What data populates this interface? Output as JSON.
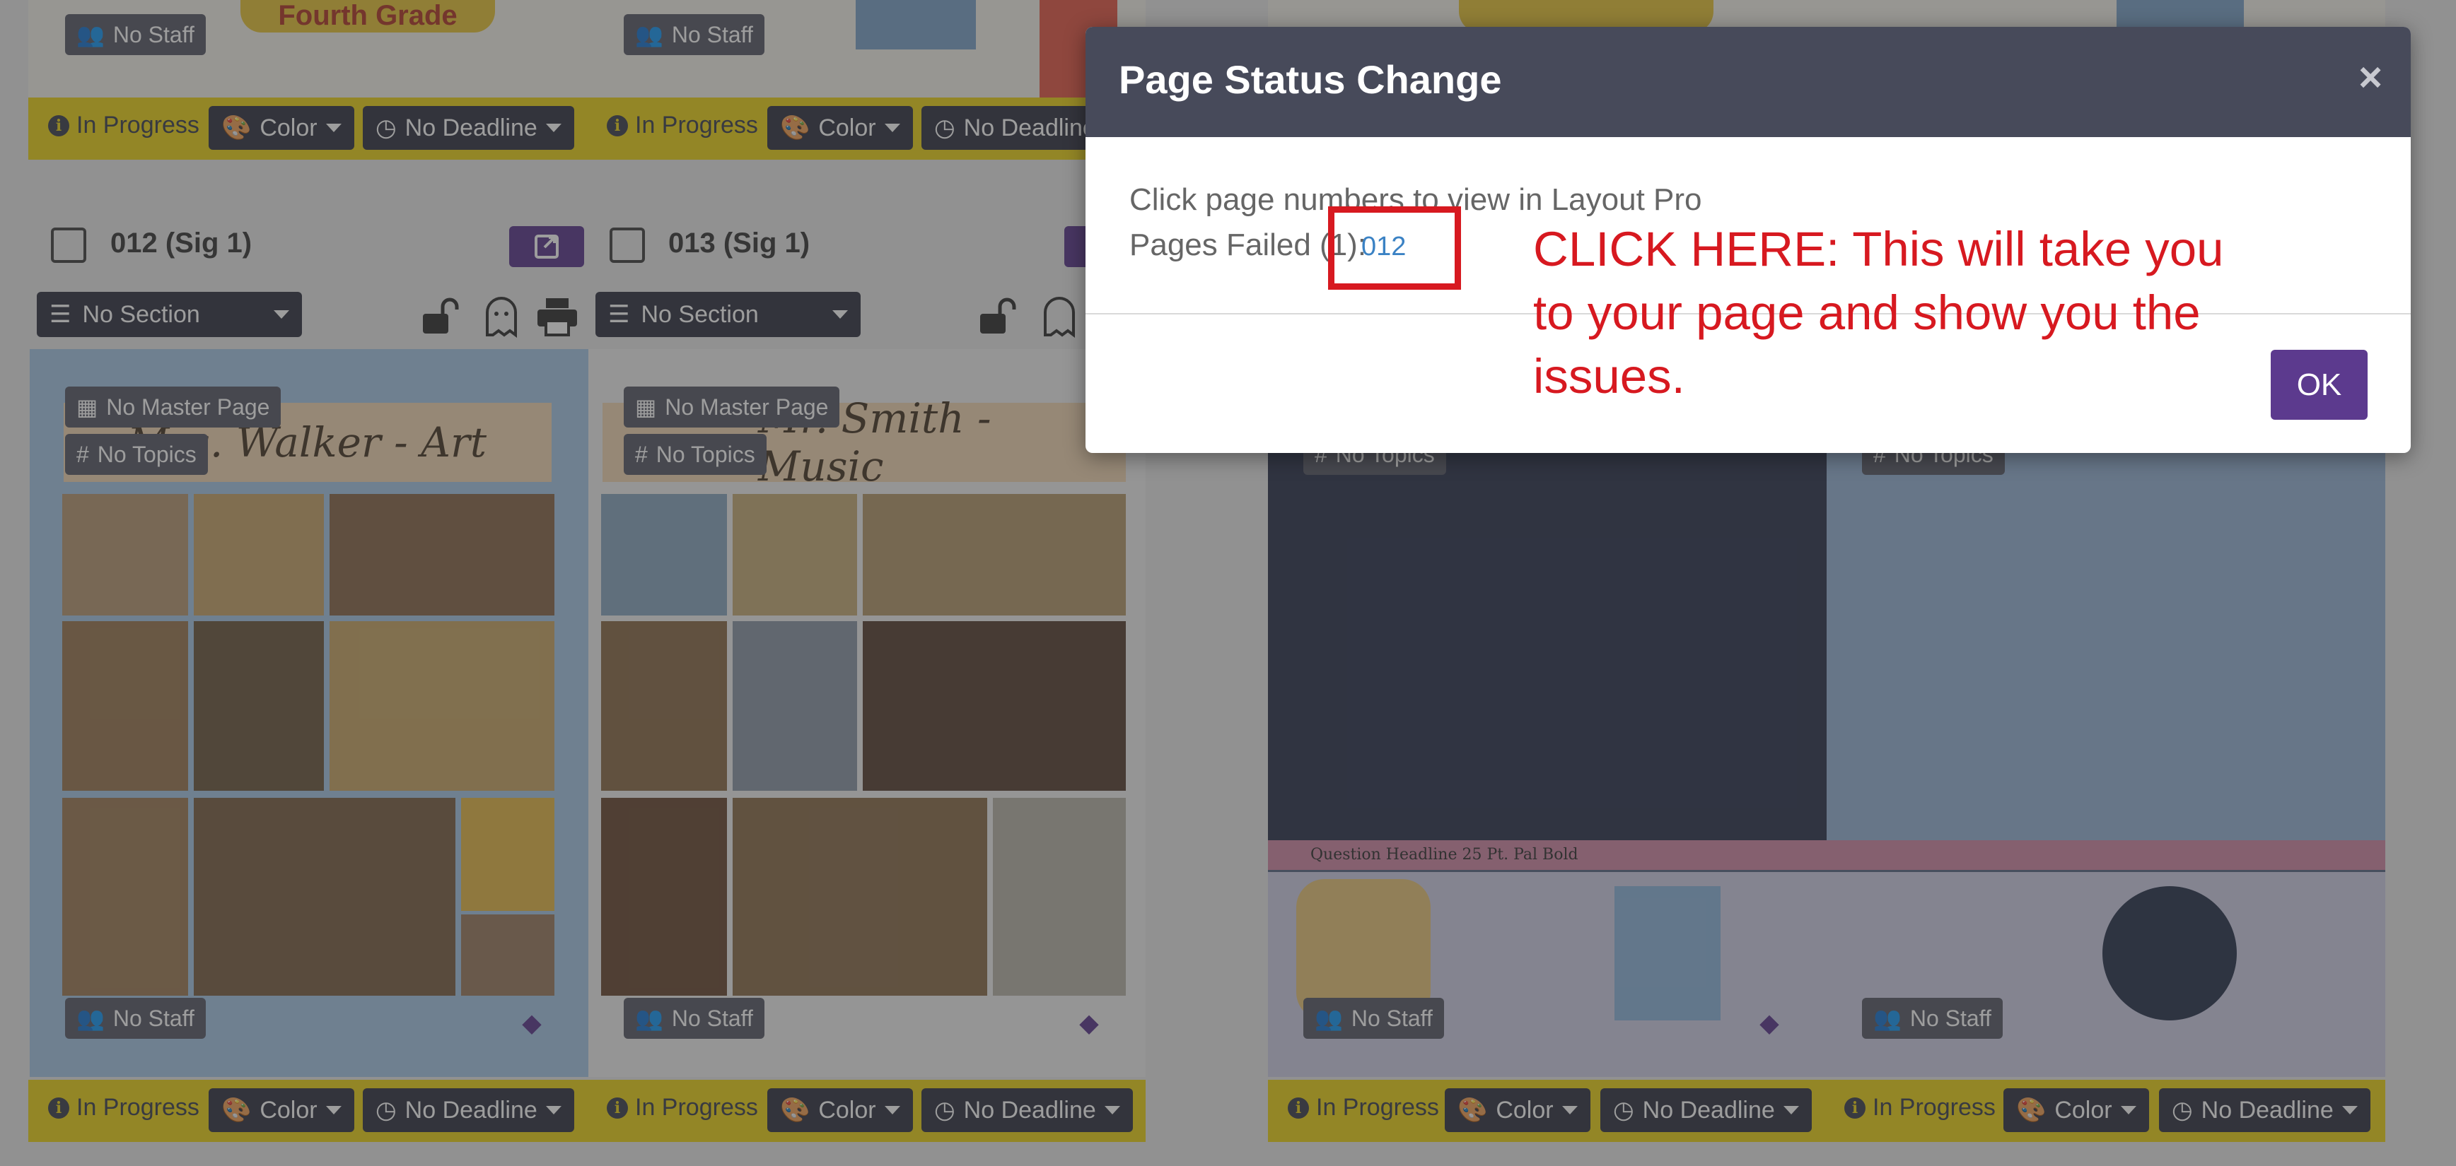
{
  "colors": {
    "strip": "#ecd31b",
    "pill": "#343745",
    "accent": "#5c3a8e",
    "callout": "#d71920",
    "link": "#3b82c4"
  },
  "pages": [
    {
      "number": "012 (Sig 1)",
      "section": "No Section",
      "master_page": "No Master Page",
      "topics": "No Topics",
      "staff": "No Staff",
      "status": "In Progress",
      "color": "Color",
      "deadline": "No Deadline",
      "banner": "Mrs. Walker - Art"
    },
    {
      "number": "013 (Sig 1)",
      "section": "No Section",
      "master_page": "No Master Page",
      "topics": "No Topics",
      "staff": "No Staff",
      "status": "In Progress",
      "color": "Color",
      "deadline": "No Deadline",
      "banner": "Mr. Smith - Music"
    }
  ],
  "top_row": {
    "staff": "No Staff",
    "status": "In Progress",
    "color": "Color",
    "deadline": "No Deadline",
    "banner": "Fourth Grade"
  },
  "right_spread": {
    "topics": "No Topics",
    "staff": "No Staff",
    "status": "In Progress",
    "color": "Color",
    "deadline": "No Deadline",
    "question_headline": "Question Headline 25 Pt. Pal Bold"
  },
  "modal": {
    "title": "Page Status Change",
    "close": "×",
    "instruction": "Click page numbers to view in Layout Pro",
    "failed_label": "Pages Failed (1):",
    "failed_page": "012",
    "ok": "OK"
  },
  "annotation": {
    "text": "CLICK HERE: This will take you to your page and show you the issues."
  }
}
